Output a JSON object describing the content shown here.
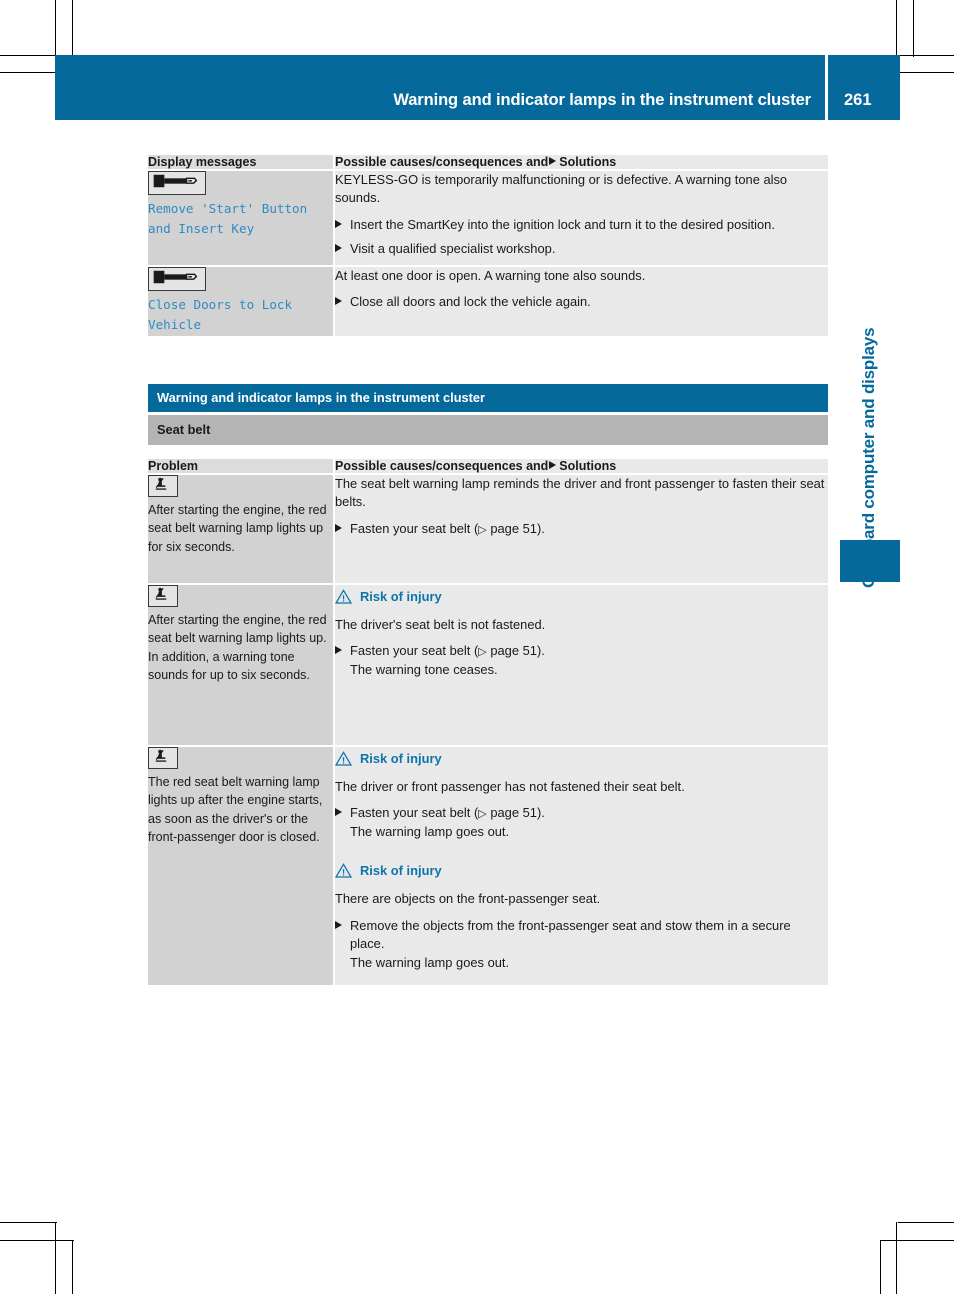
{
  "page": {
    "number": "261",
    "header_title": "Warning and indicator lamps in the instrument cluster",
    "side_tab_label": "On-board computer and displays",
    "accent_blue": "#06699c",
    "message_blue": "#2e8bc4",
    "warning_blue": "#0e74aa"
  },
  "table1": {
    "headers": {
      "col1": "Display messages",
      "col2_pre": "Possible causes/consequences and",
      "col2_post": "Solutions"
    },
    "rows": [
      {
        "icon": "key-in-slot-icon",
        "message": "Remove 'Start' Button and Insert Key",
        "cause": "KEYLESS-GO is temporarily malfunctioning or is defective. A warning tone also sounds.",
        "steps": [
          {
            "text": "Insert the SmartKey into the ignition lock and turn it to the desired position."
          },
          {
            "text": "Visit a qualified specialist workshop."
          }
        ]
      },
      {
        "icon": "key-in-slot-icon",
        "message": "Close Doors to Lock Vehicle",
        "cause": "At least one door is open. A warning tone also sounds.",
        "steps": [
          {
            "text": "Close all doors and lock the vehicle again."
          }
        ]
      }
    ]
  },
  "section": {
    "blue_heading": "Warning and indicator lamps in the instrument cluster",
    "gray_heading": "Seat belt"
  },
  "table2": {
    "headers": {
      "col1": "Problem",
      "col2_pre": "Possible causes/consequences and",
      "col2_post": "Solutions"
    },
    "rows": [
      {
        "icon": "seat-belt-warning-icon",
        "problem": "After starting the engine, the red seat belt warning lamp lights up for six seconds.",
        "blocks": [
          {
            "warning": null,
            "cause": "The seat belt warning lamp reminds the driver and front passenger to fasten their seat belts.",
            "steps": [
              {
                "text": "Fasten your seat belt (",
                "ref": "page 51",
                "tail": ").",
                "sub": null
              }
            ]
          }
        ]
      },
      {
        "icon": "seat-belt-warning-icon",
        "problem": "After starting the engine, the red seat belt warning lamp lights up. In addition, a warning tone sounds for up to six seconds.",
        "blocks": [
          {
            "warning": "Risk of injury",
            "cause": "The driver's seat belt is not fastened.",
            "steps": [
              {
                "text": "Fasten your seat belt (",
                "ref": "page 51",
                "tail": ").",
                "sub": "The warning tone ceases."
              }
            ]
          }
        ]
      },
      {
        "icon": "seat-belt-warning-icon",
        "problem": "The red seat belt warning lamp lights up after the engine starts, as soon as the driver's or the front-passenger door is closed.",
        "blocks": [
          {
            "warning": "Risk of injury",
            "cause": "The driver or front passenger has not fastened their seat belt.",
            "steps": [
              {
                "text": "Fasten your seat belt (",
                "ref": "page 51",
                "tail": ").",
                "sub": "The warning lamp goes out."
              }
            ]
          },
          {
            "warning": "Risk of injury",
            "cause": "There are objects on the front-passenger seat.",
            "steps": [
              {
                "text": "Remove the objects from the front-passenger seat and stow them in a secure place.",
                "ref": null,
                "tail": null,
                "sub": "The warning lamp goes out."
              }
            ]
          }
        ]
      }
    ]
  }
}
